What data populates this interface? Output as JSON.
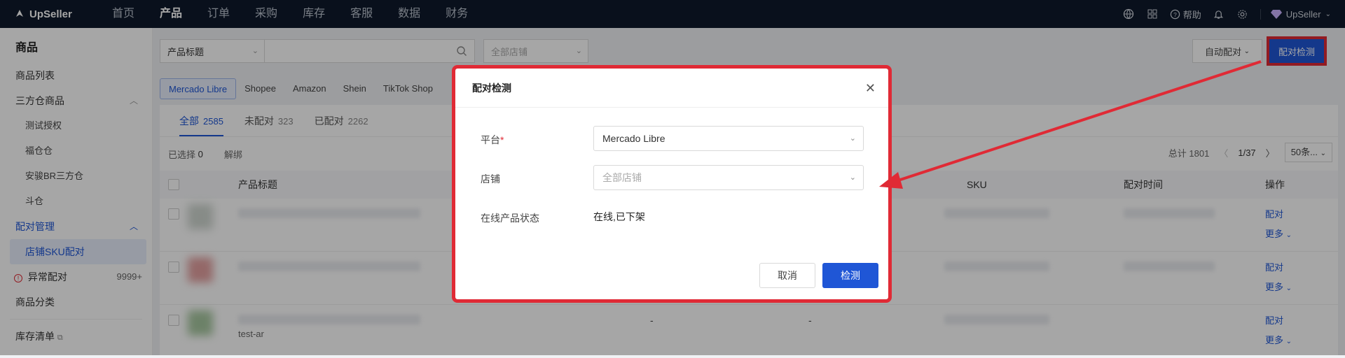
{
  "topbar": {
    "logo": "UpSeller",
    "nav": [
      "首页",
      "产品",
      "订单",
      "采购",
      "库存",
      "客服",
      "数据",
      "财务"
    ],
    "active_nav": "产品",
    "help": "帮助",
    "user": "UpSeller"
  },
  "sidebar": {
    "title": "商品",
    "items": {
      "list": "商品列表",
      "third": "三方仓商品",
      "test_auth": "测试授权",
      "fucang": "福仓仓",
      "anjun": "安骏BR三方仓",
      "dou": "斗仓",
      "match_mgmt": "配对管理",
      "store_sku": "店铺SKU配对",
      "abnormal": "异常配对",
      "abnormal_count": "9999+",
      "category": "商品分类",
      "stock_list": "库存清单"
    }
  },
  "filters": {
    "title_select": "产品标题",
    "store_placeholder": "全部店铺",
    "auto_match": "自动配对",
    "detect_button": "配对检测"
  },
  "platform_tabs": [
    "Mercado Libre",
    "Shopee",
    "Amazon",
    "Shein",
    "TikTok Shop"
  ],
  "status_tabs": [
    {
      "label": "全部",
      "count": "2585"
    },
    {
      "label": "未配对",
      "count": "323"
    },
    {
      "label": "已配对",
      "count": "2262"
    }
  ],
  "toolbar": {
    "selected_label": "已选择",
    "selected_count": "0",
    "unbind": "解绑",
    "total_label": "总计 1801",
    "page": "1/37",
    "page_size": "50条..."
  },
  "table": {
    "headers": {
      "title": "产品标题",
      "sku": "SKU",
      "time": "配对时间",
      "ops": "操作"
    },
    "op_match": "配对",
    "op_more": "更多",
    "row3_dash1": "-",
    "row3_dash2": "-",
    "row3_title": "test-ar"
  },
  "modal": {
    "title": "配对检测",
    "platform_label": "平台",
    "platform_value": "Mercado Libre",
    "store_label": "店铺",
    "store_placeholder": "全部店铺",
    "status_label": "在线产品状态",
    "status_value": "在线,已下架",
    "cancel": "取消",
    "confirm": "检测"
  },
  "colors": {
    "accent": "#1f56d6",
    "highlight": "#e02a35",
    "topbar": "#0e1a2b"
  }
}
